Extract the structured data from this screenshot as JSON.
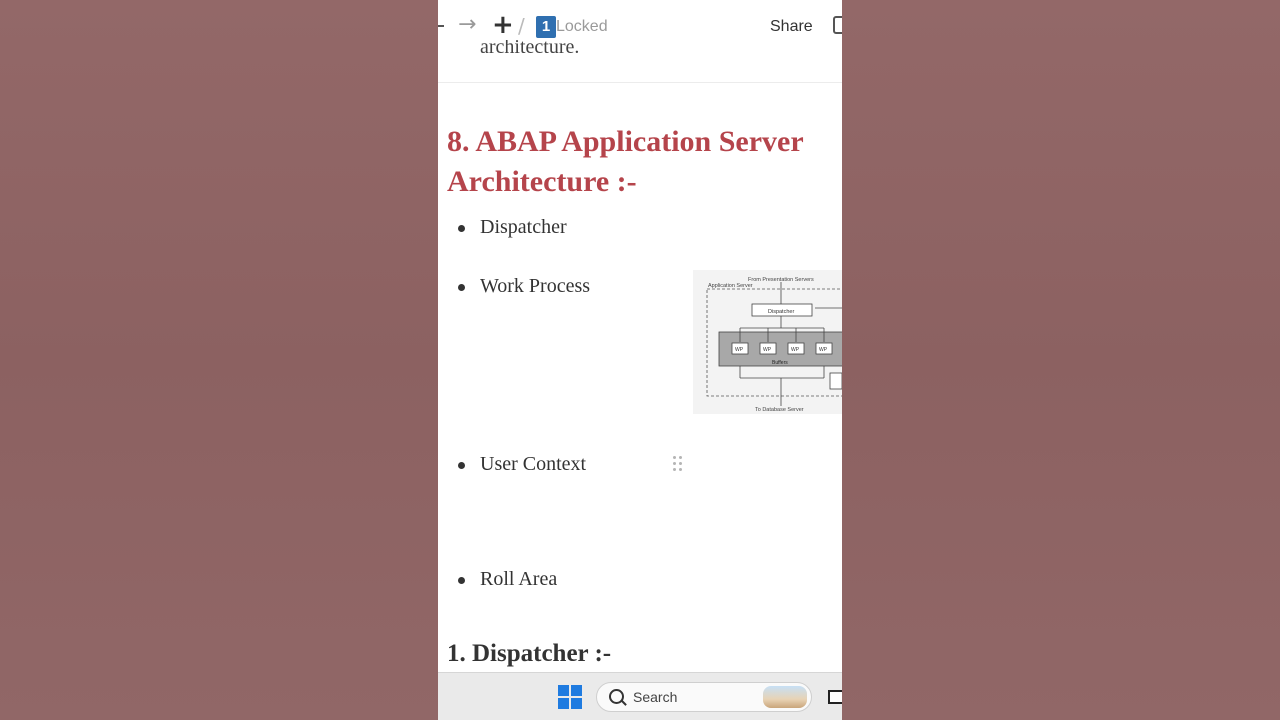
{
  "topbar": {
    "locked_label": "Locked",
    "page_badge": "1",
    "share_label": "Share",
    "partial_prev_text": "architecture."
  },
  "section": {
    "title_line1": "8. ABAP Application Server",
    "title_line2": "Architecture :-",
    "bullets": [
      "Dispatcher",
      "Work Process",
      "User Context",
      "Roll Area"
    ]
  },
  "diagram": {
    "top_caption": "From Presentation Servers",
    "box_label": "Application Server",
    "dispatcher_label": "Dispatcher",
    "wp_label": "WP",
    "buffers_label": "Buffers",
    "bottom_caption": "To Database Server"
  },
  "subsection": {
    "title": "1. Dispatcher :-"
  },
  "taskbar": {
    "search_label": "Search"
  },
  "colors": {
    "heading_red": "#b5444b",
    "backdrop": "#8f6464",
    "windows_blue": "#1f7be0"
  }
}
